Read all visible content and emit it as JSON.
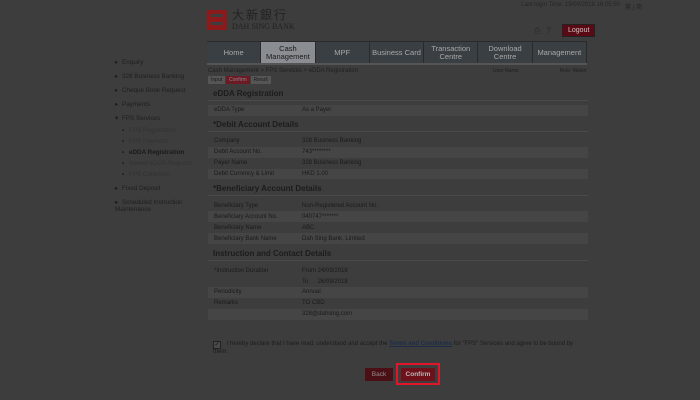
{
  "header": {
    "logo_cn": "大新銀行",
    "logo_en": "DAH SING BANK",
    "login_time": "Last login Time: 19/09/2018 16:05:50",
    "lang": "繁 | 简",
    "icons": [
      "printer-icon",
      "help-icon"
    ],
    "logout_label": "Logout"
  },
  "nav": [
    {
      "label": "Home"
    },
    {
      "label": "Cash Management",
      "active": true
    },
    {
      "label": "MPF"
    },
    {
      "label": "Business Card"
    },
    {
      "label": "Transaction Centre"
    },
    {
      "label": "Download Centre"
    },
    {
      "label": "Management"
    }
  ],
  "breadcrumb": "Cash Management > FPS Services > eDDA Registration",
  "user_meta": {
    "user_name": "User Name:",
    "role": "Role: Maker"
  },
  "steps": [
    {
      "label": "Input"
    },
    {
      "label": "Confirm",
      "current": true
    },
    {
      "label": "Result"
    }
  ],
  "sidebar": {
    "items": [
      {
        "label": "Enquiry"
      },
      {
        "label": "328 Business Banking"
      },
      {
        "label": "Cheque Book Request"
      },
      {
        "label": "Payments"
      },
      {
        "label": "FPS Services",
        "expanded": true
      },
      {
        "label": "FPS Registration",
        "sub": true
      },
      {
        "label": "FPS Payment",
        "sub": true
      },
      {
        "label": "eDDA Registration",
        "sub": true,
        "active": true
      },
      {
        "label": "Inward eDDA Request",
        "sub": true
      },
      {
        "label": "FPS Collection",
        "sub": true
      },
      {
        "label": "Fixed Deposit"
      },
      {
        "label": "Scheduled Instruction Maintenance"
      }
    ]
  },
  "edda": {
    "title": "eDDA Registration",
    "type_label": "eDDA Type",
    "type_value": "As a Payer"
  },
  "debit": {
    "title": "*Debit Account Details",
    "rows": [
      {
        "k": "Company",
        "v": "328 Business Banking"
      },
      {
        "k": "Debit Account No.",
        "v": "743********"
      },
      {
        "k": "Payer Name",
        "v": "328 Business Banking"
      },
      {
        "k": "Debit Currency & Limit",
        "v": "HKD 1.00"
      }
    ]
  },
  "beneficiary": {
    "title": "*Beneficiary Account Details",
    "rows": [
      {
        "k": "Beneficiary Type",
        "v": "Non-Registered Account No."
      },
      {
        "k": "Beneficiary Account No.",
        "v": "040747*******"
      },
      {
        "k": "Beneficiary Name",
        "v": "ABC"
      },
      {
        "k": "Beneficiary Bank Name",
        "v": "Dah Sing Bank, Limited"
      }
    ]
  },
  "instruction": {
    "title": "Instruction and Contact Details",
    "duration_label": "*Instruction Duration",
    "from_label": "From",
    "from_value": "24/09/2018",
    "to_label": "To",
    "to_value": "26/09/2018",
    "rows": [
      {
        "k": "Periodicity",
        "v": "Annual"
      },
      {
        "k": "Remarks",
        "v": "TO CBD"
      },
      {
        "k": "",
        "v": "328@dahsing.com"
      }
    ]
  },
  "declaration": {
    "prefix": "I hereby declare that I have read, understand and accept the",
    "link": "Terms and Conditions",
    "suffix": "for \"FPS\" Services and agree to be bound by them.",
    "checked": true
  },
  "buttons": {
    "back": "Back",
    "confirm": "Confirm"
  },
  "colors": {
    "highlight": "#e2162a",
    "brand": "#8c1a1a"
  }
}
